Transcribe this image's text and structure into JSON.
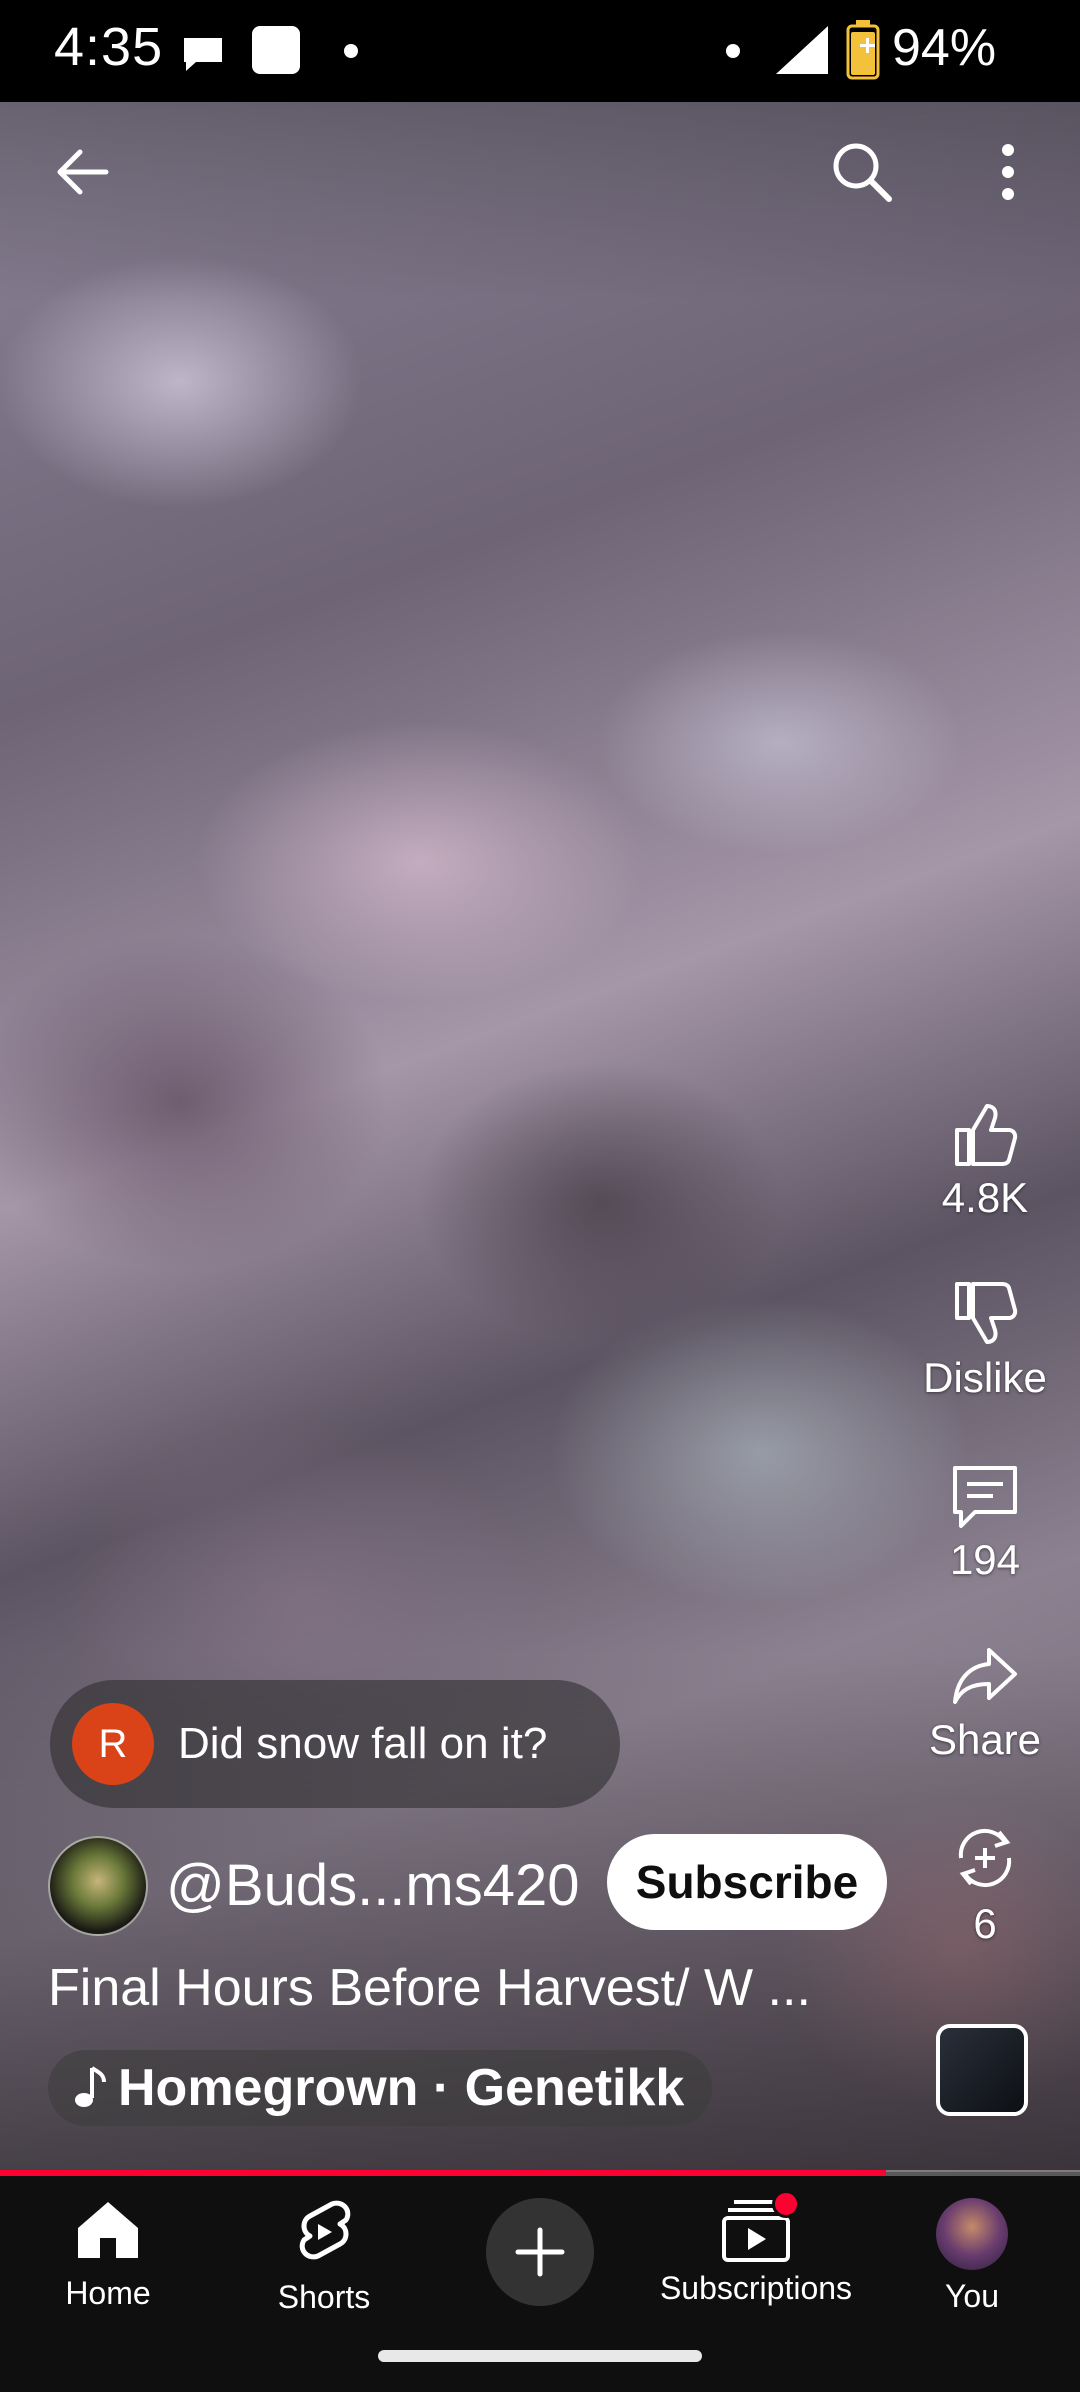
{
  "status_bar": {
    "time": "4:35",
    "battery": "94%"
  },
  "top_bar": {
    "back_icon": "arrow-left-icon",
    "search_icon": "search-icon",
    "more_icon": "more-vert-icon"
  },
  "actions": {
    "like_count": "4.8K",
    "dislike_label": "Dislike",
    "comment_count": "194",
    "share_label": "Share",
    "remix_count": "6"
  },
  "comment_preview": {
    "avatar_letter": "R",
    "avatar_color": "#d94317",
    "text": "Did snow fall on it?"
  },
  "channel": {
    "handle": "@Buds...ms420",
    "subscribe_label": "Subscribe"
  },
  "video": {
    "title": "Final Hours Before Harvest/ W ...",
    "music": "Homegrown · Genetikk",
    "progress": 0.82
  },
  "bottom_nav": {
    "items": [
      {
        "label": "Home",
        "icon": "home-icon"
      },
      {
        "label": "Shorts",
        "icon": "shorts-icon"
      },
      {
        "label": "",
        "icon": "create-icon"
      },
      {
        "label": "Subscriptions",
        "icon": "subscriptions-icon"
      },
      {
        "label": "You",
        "icon": "avatar"
      }
    ]
  },
  "colors": {
    "accent": "#ff0033",
    "nav_bg": "#0f0f0f"
  }
}
